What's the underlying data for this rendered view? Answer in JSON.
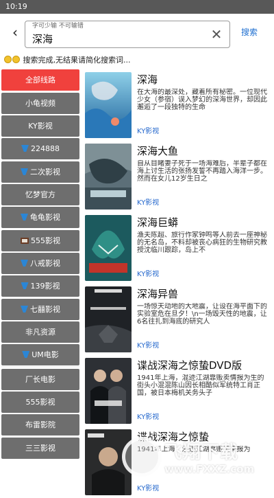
{
  "status_bar": {
    "time": "10:19"
  },
  "search": {
    "hint": "字可少输 不可输错",
    "value": "深海",
    "button": "搜索"
  },
  "notice": "搜索完成,无结果请简化搜索词...",
  "sidebar": {
    "items": [
      {
        "label": "全部线路",
        "active": true
      },
      {
        "label": "小龟视频"
      },
      {
        "label": "KY影视"
      },
      {
        "label": "224888",
        "icon": "k-flag-icon"
      },
      {
        "label": "二次影视",
        "icon": "k-flag-icon"
      },
      {
        "label": "忆梦官方"
      },
      {
        "label": "龟龟影视",
        "icon": "k-flag-icon"
      },
      {
        "label": "555影视",
        "icon": "box-icon"
      },
      {
        "label": "八戒影视",
        "icon": "k-flag-icon"
      },
      {
        "label": "139影视",
        "icon": "k-flag-icon"
      },
      {
        "label": "七囍影视",
        "icon": "k-flag-icon"
      },
      {
        "label": "非凡资源"
      },
      {
        "label": "UM电影",
        "icon": "k-flag-icon"
      },
      {
        "label": "厂长电影"
      },
      {
        "label": "555影视"
      },
      {
        "label": "布雷影院"
      },
      {
        "label": "三三影视"
      }
    ]
  },
  "results": [
    {
      "title": "深海",
      "desc": "在大海的最深处，藏着所有秘密。一位现代少女（参宿）误入梦幻的深海世界，却因此邂逅了一段独特的生命",
      "source": "KY影视",
      "poster_color": "#3f86b8"
    },
    {
      "title": "深海大鱼",
      "desc": "自从目睹妻子死于一场海难后，半辈子都在海上讨生活的张扬发誓不再踏入海洋一步。然而在女儿12岁生日之",
      "source": "KY影视",
      "poster_color": "#4a5f6a"
    },
    {
      "title": "深海巨蟒",
      "desc": "渔夫陈超、旅行作家钟鸣等人前去一座神秘的无名岛，不料却被丧心病狂的生物研究教授沈临川跟踪，岛上不",
      "source": "KY影视",
      "poster_color": "#1f6a6c"
    },
    {
      "title": "深海异兽",
      "desc": "一场惊天动地的大地震，让设在海平面下的实验室危在旦夕！\\n一场毁天性的地震，让6名往扎到海底的研究人",
      "source": "KY影视",
      "poster_color": "#2c2f33"
    },
    {
      "title": "谍战深海之惊蛰DVD版",
      "desc": "1941年上海，混迹江湖靠贩卖情报为生的街头小混混陈山因长相酷似军统特工肖正国，被日本梅机关务头子",
      "source": "KY影视",
      "poster_color": "#3a3d42"
    },
    {
      "title": "谍战深海之惊蛰",
      "desc": "1941年上海，混迹江湖靠贩卖情报为",
      "source": "KY影视",
      "poster_color": "#2e2f30"
    }
  ],
  "watermark": {
    "brand": "飞翔下载",
    "url": "www.FXXZ.com"
  }
}
